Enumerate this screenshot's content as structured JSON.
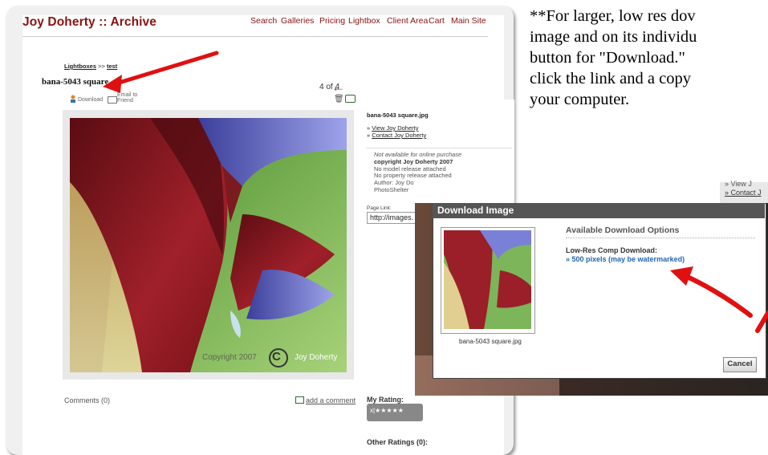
{
  "site": {
    "title": "Joy Doherty :: Archive",
    "nav": [
      "Search",
      "Galleries",
      "Pricing",
      "Lightbox",
      "Client Area",
      "Cart",
      "Main Site"
    ]
  },
  "breadcrumb": {
    "lightboxes": "Lightboxes",
    "sep": ">>",
    "current": "test"
  },
  "image": {
    "title": "bana-5043 square",
    "counter": "4 of 4",
    "watermark_copyright": "Copyright 2007",
    "watermark_name": "Joy Doherty"
  },
  "tools": {
    "download": "Download",
    "email_line1": "Email to",
    "email_line2": "Friend"
  },
  "sidebar": {
    "filename": "bana-5043 square.jpg",
    "view_link": "View Joy Doherty",
    "contact_link": "Contact Joy Doherty",
    "info": [
      "Not available for online purchase",
      "copyright Joy Doherty 2007",
      "No model release attached",
      "No property release attached",
      "Author: Joy Do",
      "PhotoShelter"
    ],
    "page_link_label": "Page Link:",
    "page_link_value": "http://images."
  },
  "footer": {
    "comments": "Comments (0)",
    "add_comment": "add a comment",
    "my_rating": "My Rating:",
    "rating_box": "x|★★★★★",
    "other_ratings": "Other Ratings (0):"
  },
  "instructions": [
    "**For larger, low res dov",
    "image and on its individu",
    "button for \"Download.\"",
    "click the link and a copy",
    "your computer."
  ],
  "dialog": {
    "title": "Download Image",
    "heading": "Available Download Options",
    "lowres_label": "Low-Res Comp Download:",
    "option_link": "» 500 pixels (may be watermarked)",
    "filename": "bana-5043 square.jpg",
    "cancel": "Cancel"
  },
  "behind_strip": [
    "» View J",
    "» Contact J"
  ],
  "colors": {
    "brand": "#8a1111",
    "link_blue": "#2166b3",
    "arrow_red": "#e01010"
  }
}
